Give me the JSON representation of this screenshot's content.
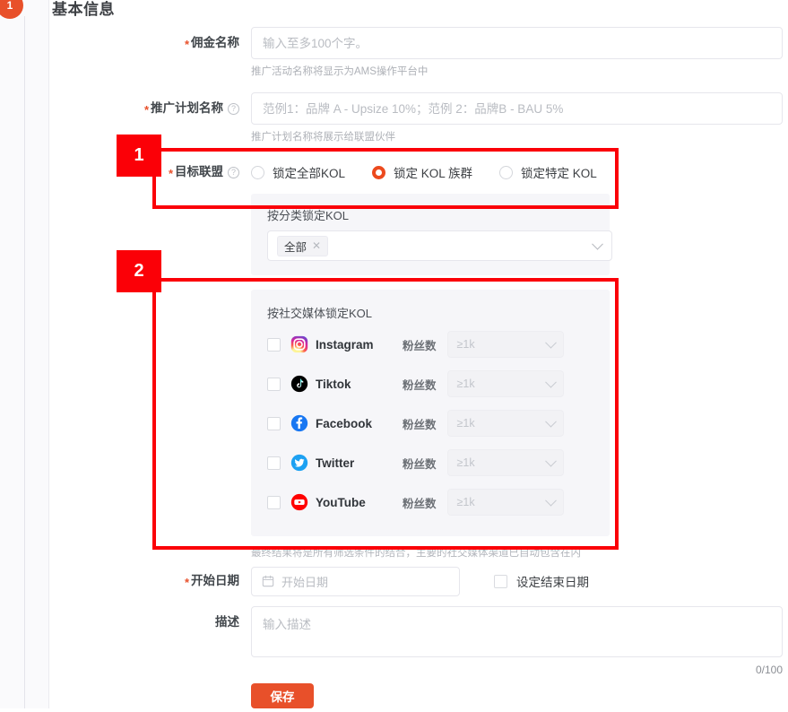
{
  "step_badge": {
    "number": "1"
  },
  "page_title": "基本信息",
  "form": {
    "commission_name": {
      "label": "佣金名称",
      "required": true,
      "placeholder": "输入至多100个字。",
      "value": "",
      "hint": "推广活动名称将显示为AMS操作平台中"
    },
    "plan_name": {
      "label": "推广计划名称",
      "required": true,
      "has_help_icon": true,
      "help_icon": "question-circle-icon",
      "placeholder": "范例1：品牌 A - Upsize 10%；范例 2：品牌B - BAU 5%",
      "value": "",
      "hint": "推广计划名称将展示给联盟伙伴"
    },
    "target_alliance": {
      "label": "目标联盟",
      "required": true,
      "has_help_icon": true,
      "help_icon": "question-circle-icon",
      "options": [
        {
          "label": "锁定全部KOL",
          "selected": false
        },
        {
          "label": "锁定 KOL 族群",
          "selected": true
        },
        {
          "label": "锁定特定 KOL",
          "selected": false
        }
      ]
    },
    "category_panel": {
      "title": "按分类锁定KOL",
      "tag": "全部",
      "tag_remove_icon": "close-icon",
      "caret_icon": "chevron-down-icon"
    },
    "social_panel": {
      "title": "按社交媒体锁定KOL",
      "fans_label": "粉丝数",
      "fans_placeholder": "≥1k",
      "caret_icon": "chevron-down-icon",
      "rows": [
        {
          "name": "Instagram",
          "icon": "instagram-icon",
          "checked": false,
          "color": "#e1306c"
        },
        {
          "name": "Tiktok",
          "icon": "tiktok-icon",
          "checked": false,
          "color": "#000000"
        },
        {
          "name": "Facebook",
          "icon": "facebook-icon",
          "checked": false,
          "color": "#1877f2"
        },
        {
          "name": "Twitter",
          "icon": "twitter-icon",
          "checked": false,
          "color": "#1da1f2"
        },
        {
          "name": "YouTube",
          "icon": "youtube-icon",
          "checked": false,
          "color": "#ff0000"
        }
      ],
      "footnote": "最终结果将是所有筛选条件的结合，主要的社交媒体渠道已自动包含在内"
    },
    "start_date": {
      "label": "开始日期",
      "required": true,
      "placeholder": "开始日期",
      "value": "",
      "calendar_icon": "calendar-icon",
      "end_date_checkbox_label": "设定结束日期",
      "end_date_checked": false
    },
    "description": {
      "label": "描述",
      "required": false,
      "placeholder": "输入描述",
      "value": "",
      "counter": "0/100"
    },
    "save_label": "保存"
  },
  "annotations": [
    {
      "number": "1"
    },
    {
      "number": "2"
    }
  ],
  "colors": {
    "accent": "#e8502a",
    "radio_selected": "#ec4a1e",
    "annotation": "#fb0007",
    "panel_bg": "#f6f6f9"
  }
}
